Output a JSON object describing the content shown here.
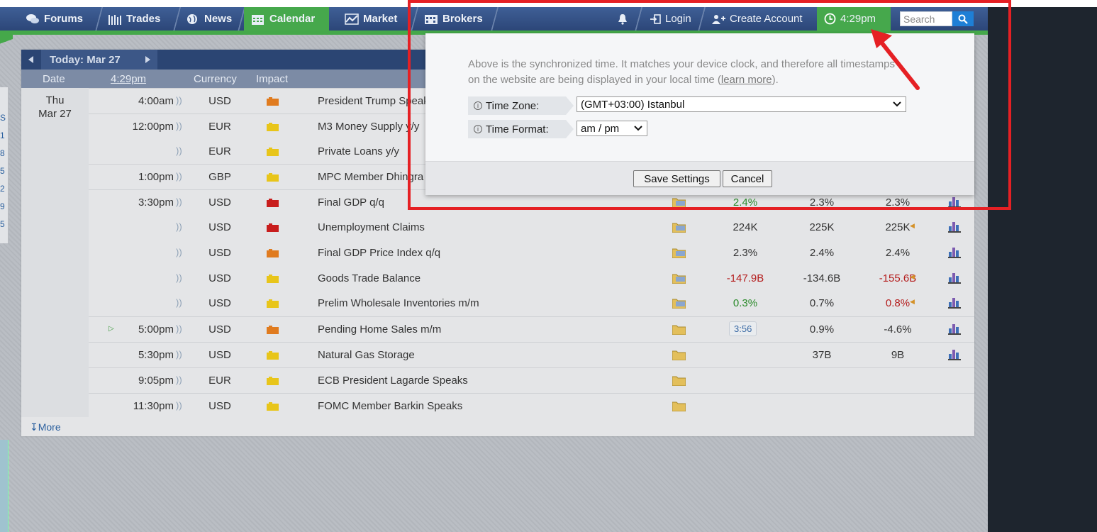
{
  "nav": {
    "items": [
      {
        "label": "Forums",
        "icon": "chat-bubbles-icon"
      },
      {
        "label": "Trades",
        "icon": "bar-columns-icon"
      },
      {
        "label": "News",
        "icon": "globe-icon"
      },
      {
        "label": "Calendar",
        "icon": "calendar-icon"
      },
      {
        "label": "Market",
        "icon": "line-chart-icon"
      },
      {
        "label": "Brokers",
        "icon": "brokers-building-icon"
      }
    ],
    "login": "Login",
    "create_account": "Create Account",
    "clock_time": "4:29pm",
    "search_placeholder": "Search"
  },
  "calendar": {
    "today_label": "Today: Mar 27",
    "columns": {
      "date": "Date",
      "time": "4:29pm",
      "currency": "Currency",
      "impact": "Impact"
    },
    "date_cell": {
      "day": "Thu",
      "date": "Mar 27"
    },
    "rows": [
      {
        "time": "4:00am",
        "currency": "USD",
        "impact": "orange",
        "event": "President Trump Speaks",
        "actual": "",
        "forecast": "",
        "previous": ""
      },
      {
        "time": "12:00pm",
        "currency": "EUR",
        "impact": "yellow",
        "event": "M3 Money Supply y/y",
        "actual": "",
        "forecast": "",
        "previous": ""
      },
      {
        "time": "",
        "currency": "EUR",
        "impact": "yellow",
        "event": "Private Loans y/y",
        "actual": "",
        "forecast": "",
        "previous": ""
      },
      {
        "time": "1:00pm",
        "currency": "GBP",
        "impact": "yellow",
        "event": "MPC Member Dhingra Speaks",
        "actual": "",
        "forecast": "",
        "previous": ""
      },
      {
        "time": "3:30pm",
        "currency": "USD",
        "impact": "red",
        "event": "Final GDP q/q",
        "actual": "2.4%",
        "actual_color": "green",
        "forecast": "2.3%",
        "previous": "2.3%"
      },
      {
        "time": "",
        "currency": "USD",
        "impact": "red",
        "event": "Unemployment Claims",
        "actual": "224K",
        "forecast": "225K",
        "previous": "225K",
        "prev_revised": true
      },
      {
        "time": "",
        "currency": "USD",
        "impact": "orange",
        "event": "Final GDP Price Index q/q",
        "actual": "2.3%",
        "forecast": "2.4%",
        "previous": "2.4%"
      },
      {
        "time": "",
        "currency": "USD",
        "impact": "yellow",
        "event": "Goods Trade Balance",
        "actual": "-147.9B",
        "actual_color": "red",
        "forecast": "-134.6B",
        "previous": "-155.6B",
        "prev_color": "red",
        "prev_revised": true
      },
      {
        "time": "",
        "currency": "USD",
        "impact": "yellow",
        "event": "Prelim Wholesale Inventories m/m",
        "actual": "0.3%",
        "actual_color": "green",
        "forecast": "0.7%",
        "previous": "0.8%",
        "prev_color": "red",
        "prev_revised": true
      },
      {
        "time": "5:00pm",
        "currency": "USD",
        "impact": "orange",
        "event": "Pending Home Sales m/m",
        "countdown": "3:56",
        "forecast": "0.9%",
        "previous": "-4.6%",
        "upnext": true
      },
      {
        "time": "5:30pm",
        "currency": "USD",
        "impact": "yellow",
        "event": "Natural Gas Storage",
        "actual": "",
        "forecast": "37B",
        "previous": "9B"
      },
      {
        "time": "9:05pm",
        "currency": "EUR",
        "impact": "yellow",
        "event": "ECB President Lagarde Speaks",
        "actual": "",
        "forecast": "",
        "previous": "",
        "nograph": true
      },
      {
        "time": "11:30pm",
        "currency": "USD",
        "impact": "yellow",
        "event": "FOMC Member Barkin Speaks",
        "actual": "",
        "forecast": "",
        "previous": "",
        "nograph": true
      }
    ],
    "more_label": "More"
  },
  "popup": {
    "message_before": "Above is the synchronized time. It matches your device clock, and therefore all timestamps on the website are being displayed in your local time (",
    "learn_more": "learn more",
    "message_after": ").",
    "time_zone_label": "Time Zone:",
    "time_zone_value": "(GMT+03:00) Istanbul",
    "time_format_label": "Time Format:",
    "time_format_value": "am / pm",
    "save_label": "Save Settings",
    "cancel_label": "Cancel"
  },
  "left_edge_digits": [
    "S",
    "1",
    "8",
    "5",
    "2",
    "9",
    "5"
  ],
  "colors": {
    "nav_blue": "#2c4678",
    "green": "#45a84a",
    "annotation_red": "#e52024",
    "impact_red": "#c81d1d",
    "impact_orange": "#e07b1f",
    "impact_yellow": "#e8c51a"
  }
}
